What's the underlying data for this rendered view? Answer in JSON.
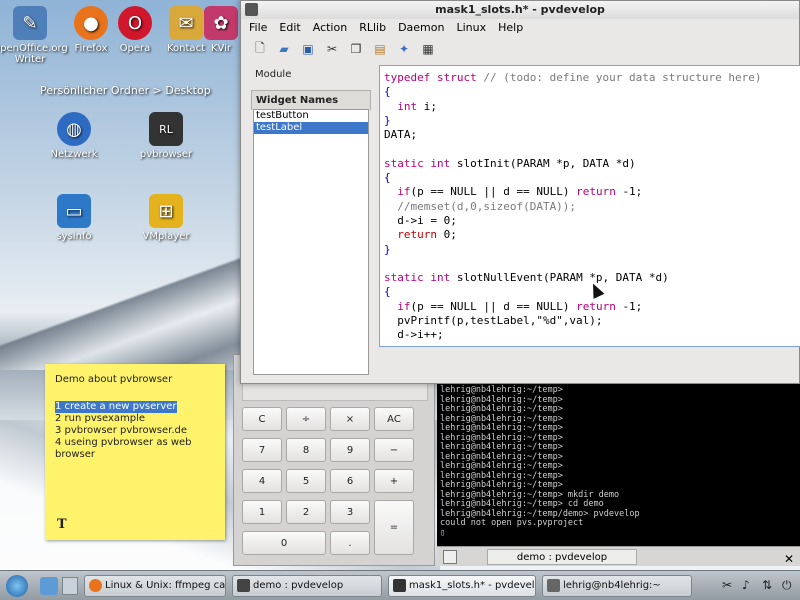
{
  "desktop": {
    "icons": [
      {
        "label": "OpenOffice.org Writer",
        "icon": "openoffice-writer-icon",
        "color": "#4e7fb8"
      },
      {
        "label": "Firefox",
        "icon": "firefox-icon",
        "color": "#e8731c"
      },
      {
        "label": "Opera",
        "icon": "opera-icon",
        "color": "#d0172b"
      },
      {
        "label": "Kontact",
        "icon": "kontact-icon",
        "color": "#d9a83a"
      },
      {
        "label": "KVir",
        "icon": "kvirc-icon",
        "color": "#c23a6b"
      },
      {
        "label": "Netzwerk",
        "icon": "network-globe-icon",
        "color": "#2e6cc4"
      },
      {
        "label": "pvbrowser",
        "icon": "pvbrowser-icon",
        "color": "#333333"
      },
      {
        "label": "sysinfo",
        "icon": "sysinfo-icon",
        "color": "#2e78c8"
      },
      {
        "label": "VMplayer",
        "icon": "vmplayer-icon",
        "color": "#e3b21c"
      }
    ],
    "folder_path": "Persönlicher Ordner > Desktop"
  },
  "pvdevelop": {
    "title": "mask1_slots.h* - pvdevelop",
    "menu": [
      "File",
      "Edit",
      "Action",
      "RLlib",
      "Daemon",
      "Linux",
      "Help"
    ],
    "toolbar_icons": [
      "new-file-icon",
      "open-folder-icon",
      "save-icon",
      "cut-icon",
      "copy-icon",
      "paste-icon",
      "magic-wand-icon",
      "dialog-icon"
    ],
    "tabs": {
      "module": "Module",
      "widget_names": "Widget Names"
    },
    "widgets": [
      "testButton",
      "testLabel"
    ],
    "selected_widget": "testLabel",
    "code": [
      [
        {
          "t": "typedef struct ",
          "c": "kw"
        },
        {
          "t": "// (todo: define your data structure here)",
          "c": "cm"
        }
      ],
      [
        {
          "t": "{",
          "c": "bl"
        }
      ],
      [
        {
          "t": "  int ",
          "c": "kw"
        },
        {
          "t": "i;",
          "c": "pl"
        }
      ],
      [
        {
          "t": "}",
          "c": "bl"
        }
      ],
      [
        {
          "t": "DATA;",
          "c": "pl"
        }
      ],
      [
        {
          "t": "",
          "c": "pl"
        }
      ],
      [
        {
          "t": "static int ",
          "c": "kw"
        },
        {
          "t": "slotInit(PARAM *p, DATA *d)",
          "c": "pl"
        }
      ],
      [
        {
          "t": "{",
          "c": "bl"
        }
      ],
      [
        {
          "t": "  if",
          "c": "kw"
        },
        {
          "t": "(p == NULL || d == NULL) ",
          "c": "pl"
        },
        {
          "t": "return ",
          "c": "kw"
        },
        {
          "t": "-1;",
          "c": "pl"
        }
      ],
      [
        {
          "t": "  //memset(d,0,sizeof(DATA));",
          "c": "cm"
        }
      ],
      [
        {
          "t": "  d->i = 0;",
          "c": "pl"
        }
      ],
      [
        {
          "t": "  return ",
          "c": "rd"
        },
        {
          "t": "0;",
          "c": "pl"
        }
      ],
      [
        {
          "t": "}",
          "c": "bl"
        }
      ],
      [
        {
          "t": "",
          "c": "pl"
        }
      ],
      [
        {
          "t": "static int ",
          "c": "kw"
        },
        {
          "t": "slotNullEvent(PARAM *p, DATA *d)",
          "c": "pl"
        }
      ],
      [
        {
          "t": "{",
          "c": "bl"
        }
      ],
      [
        {
          "t": "  if",
          "c": "kw"
        },
        {
          "t": "(p == NULL || d == NULL) ",
          "c": "pl"
        },
        {
          "t": "return ",
          "c": "kw"
        },
        {
          "t": "-1;",
          "c": "pl"
        }
      ],
      [
        {
          "t": "  pvPrintf(p,testLabel,\"%d\",val);",
          "c": "pl"
        }
      ],
      [
        {
          "t": "  d->i++;",
          "c": "pl"
        }
      ]
    ]
  },
  "sticky_note": {
    "title": "Demo about pvbrowser",
    "items": [
      "1 create a new pvserver",
      "2 run pvsexample",
      "3 pvbrowser pvbrowser.de",
      "4 useing pvbrowser as web browser"
    ],
    "highlighted_index": 0,
    "tool_glyph": "T"
  },
  "calculator": {
    "buttons": [
      "C",
      "÷",
      "×",
      "AC",
      "7",
      "8",
      "9",
      "−",
      "4",
      "5",
      "6",
      "+",
      "1",
      "2",
      "3",
      "=",
      "0",
      "."
    ]
  },
  "terminal": {
    "lines": [
      "lehrig@nb4lehrig:~/temp>",
      "lehrig@nb4lehrig:~/temp>",
      "lehrig@nb4lehrig:~/temp>",
      "lehrig@nb4lehrig:~/temp>",
      "lehrig@nb4lehrig:~/temp>",
      "lehrig@nb4lehrig:~/temp>",
      "lehrig@nb4lehrig:~/temp>",
      "lehrig@nb4lehrig:~/temp>",
      "lehrig@nb4lehrig:~/temp>",
      "lehrig@nb4lehrig:~/temp>",
      "lehrig@nb4lehrig:~/temp>",
      "lehrig@nb4lehrig:~/temp> mkdir demo",
      "lehrig@nb4lehrig:~/temp> cd demo",
      "lehrig@nb4lehrig:~/temp/demo> pvdevelop",
      "could not open pvs.pvproject",
      "▯"
    ],
    "tab_label": "demo : pvdevelop"
  },
  "taskbar": {
    "tasks": [
      {
        "label": "Linux & Unix: ffmpeg capture",
        "icon": "firefox-icon",
        "color": "#e8731c"
      },
      {
        "label": "demo : pvdevelop",
        "icon": "terminal-icon",
        "color": "#444444"
      },
      {
        "label": "mask1_slots.h* - pvdevelop",
        "icon": "pvdevelop-icon",
        "color": "#333333"
      },
      {
        "label": "lehrig@nb4lehrig:~",
        "icon": "konsole-icon",
        "color": "#666666"
      }
    ],
    "active_task_index": 2,
    "tray_icons": [
      "clipboard-icon",
      "volume-icon",
      "network-icon",
      "power-icon"
    ]
  }
}
